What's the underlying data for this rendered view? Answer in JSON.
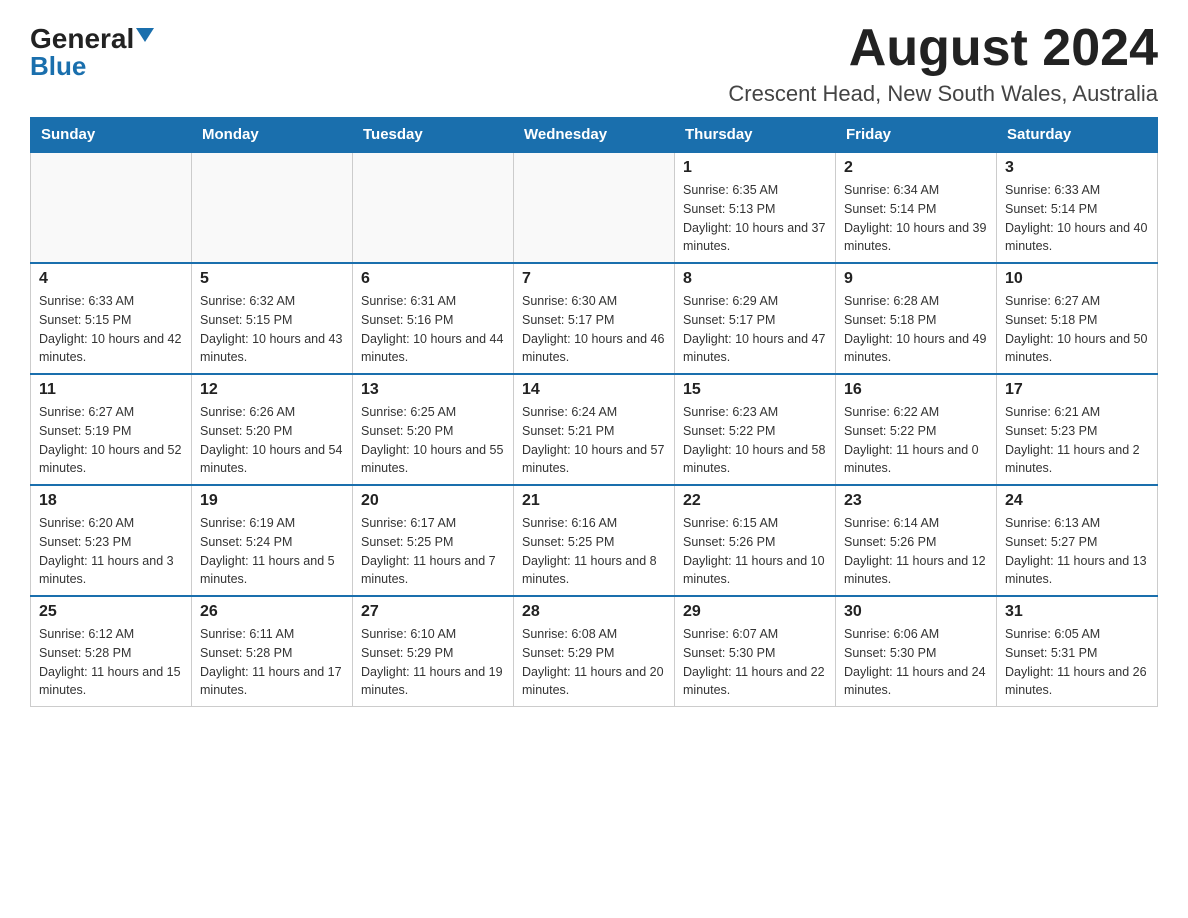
{
  "logo": {
    "text_general": "General",
    "text_blue": "Blue"
  },
  "header": {
    "title": "August 2024",
    "subtitle": "Crescent Head, New South Wales, Australia"
  },
  "days_of_week": [
    "Sunday",
    "Monday",
    "Tuesday",
    "Wednesday",
    "Thursday",
    "Friday",
    "Saturday"
  ],
  "weeks": [
    [
      {
        "day": "",
        "info": ""
      },
      {
        "day": "",
        "info": ""
      },
      {
        "day": "",
        "info": ""
      },
      {
        "day": "",
        "info": ""
      },
      {
        "day": "1",
        "info": "Sunrise: 6:35 AM\nSunset: 5:13 PM\nDaylight: 10 hours and 37 minutes."
      },
      {
        "day": "2",
        "info": "Sunrise: 6:34 AM\nSunset: 5:14 PM\nDaylight: 10 hours and 39 minutes."
      },
      {
        "day": "3",
        "info": "Sunrise: 6:33 AM\nSunset: 5:14 PM\nDaylight: 10 hours and 40 minutes."
      }
    ],
    [
      {
        "day": "4",
        "info": "Sunrise: 6:33 AM\nSunset: 5:15 PM\nDaylight: 10 hours and 42 minutes."
      },
      {
        "day": "5",
        "info": "Sunrise: 6:32 AM\nSunset: 5:15 PM\nDaylight: 10 hours and 43 minutes."
      },
      {
        "day": "6",
        "info": "Sunrise: 6:31 AM\nSunset: 5:16 PM\nDaylight: 10 hours and 44 minutes."
      },
      {
        "day": "7",
        "info": "Sunrise: 6:30 AM\nSunset: 5:17 PM\nDaylight: 10 hours and 46 minutes."
      },
      {
        "day": "8",
        "info": "Sunrise: 6:29 AM\nSunset: 5:17 PM\nDaylight: 10 hours and 47 minutes."
      },
      {
        "day": "9",
        "info": "Sunrise: 6:28 AM\nSunset: 5:18 PM\nDaylight: 10 hours and 49 minutes."
      },
      {
        "day": "10",
        "info": "Sunrise: 6:27 AM\nSunset: 5:18 PM\nDaylight: 10 hours and 50 minutes."
      }
    ],
    [
      {
        "day": "11",
        "info": "Sunrise: 6:27 AM\nSunset: 5:19 PM\nDaylight: 10 hours and 52 minutes."
      },
      {
        "day": "12",
        "info": "Sunrise: 6:26 AM\nSunset: 5:20 PM\nDaylight: 10 hours and 54 minutes."
      },
      {
        "day": "13",
        "info": "Sunrise: 6:25 AM\nSunset: 5:20 PM\nDaylight: 10 hours and 55 minutes."
      },
      {
        "day": "14",
        "info": "Sunrise: 6:24 AM\nSunset: 5:21 PM\nDaylight: 10 hours and 57 minutes."
      },
      {
        "day": "15",
        "info": "Sunrise: 6:23 AM\nSunset: 5:22 PM\nDaylight: 10 hours and 58 minutes."
      },
      {
        "day": "16",
        "info": "Sunrise: 6:22 AM\nSunset: 5:22 PM\nDaylight: 11 hours and 0 minutes."
      },
      {
        "day": "17",
        "info": "Sunrise: 6:21 AM\nSunset: 5:23 PM\nDaylight: 11 hours and 2 minutes."
      }
    ],
    [
      {
        "day": "18",
        "info": "Sunrise: 6:20 AM\nSunset: 5:23 PM\nDaylight: 11 hours and 3 minutes."
      },
      {
        "day": "19",
        "info": "Sunrise: 6:19 AM\nSunset: 5:24 PM\nDaylight: 11 hours and 5 minutes."
      },
      {
        "day": "20",
        "info": "Sunrise: 6:17 AM\nSunset: 5:25 PM\nDaylight: 11 hours and 7 minutes."
      },
      {
        "day": "21",
        "info": "Sunrise: 6:16 AM\nSunset: 5:25 PM\nDaylight: 11 hours and 8 minutes."
      },
      {
        "day": "22",
        "info": "Sunrise: 6:15 AM\nSunset: 5:26 PM\nDaylight: 11 hours and 10 minutes."
      },
      {
        "day": "23",
        "info": "Sunrise: 6:14 AM\nSunset: 5:26 PM\nDaylight: 11 hours and 12 minutes."
      },
      {
        "day": "24",
        "info": "Sunrise: 6:13 AM\nSunset: 5:27 PM\nDaylight: 11 hours and 13 minutes."
      }
    ],
    [
      {
        "day": "25",
        "info": "Sunrise: 6:12 AM\nSunset: 5:28 PM\nDaylight: 11 hours and 15 minutes."
      },
      {
        "day": "26",
        "info": "Sunrise: 6:11 AM\nSunset: 5:28 PM\nDaylight: 11 hours and 17 minutes."
      },
      {
        "day": "27",
        "info": "Sunrise: 6:10 AM\nSunset: 5:29 PM\nDaylight: 11 hours and 19 minutes."
      },
      {
        "day": "28",
        "info": "Sunrise: 6:08 AM\nSunset: 5:29 PM\nDaylight: 11 hours and 20 minutes."
      },
      {
        "day": "29",
        "info": "Sunrise: 6:07 AM\nSunset: 5:30 PM\nDaylight: 11 hours and 22 minutes."
      },
      {
        "day": "30",
        "info": "Sunrise: 6:06 AM\nSunset: 5:30 PM\nDaylight: 11 hours and 24 minutes."
      },
      {
        "day": "31",
        "info": "Sunrise: 6:05 AM\nSunset: 5:31 PM\nDaylight: 11 hours and 26 minutes."
      }
    ]
  ]
}
